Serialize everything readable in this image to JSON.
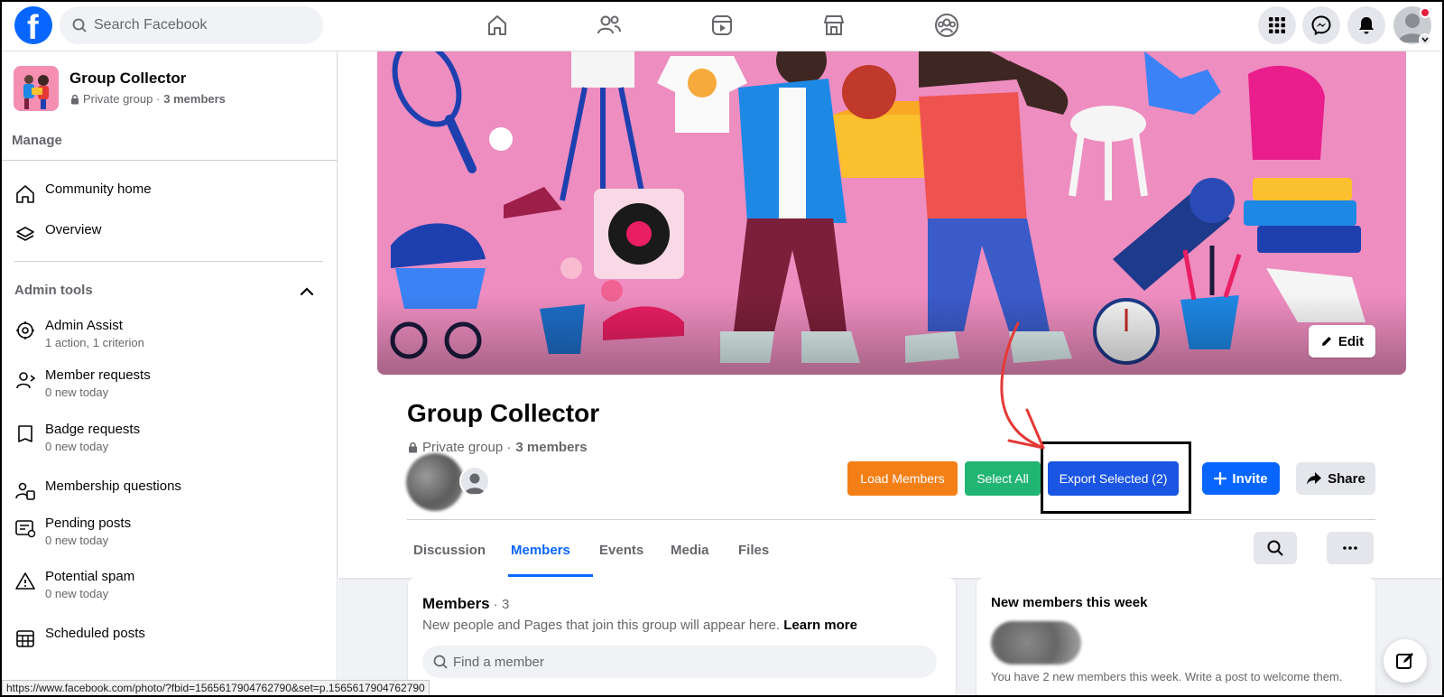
{
  "topbar": {
    "search_placeholder": "Search Facebook"
  },
  "sidebar": {
    "group_name": "Group Collector",
    "privacy": "Private group · ",
    "members": "3 members",
    "manage_label": "Manage",
    "items_top": [
      {
        "label": "Community home",
        "icon": "home-icon"
      },
      {
        "label": "Overview",
        "icon": "layers-icon"
      }
    ],
    "admin_tools_label": "Admin tools",
    "admin_items": [
      {
        "label": "Admin Assist",
        "sub": "1 action, 1 criterion",
        "icon": "admin-assist-icon"
      },
      {
        "label": "Member requests",
        "sub": "0 new today",
        "icon": "member-request-icon"
      },
      {
        "label": "Badge requests",
        "sub": "0 new today",
        "icon": "badge-icon"
      },
      {
        "label": "Membership questions",
        "sub": "",
        "icon": "questions-icon"
      },
      {
        "label": "Pending posts",
        "sub": "0 new today",
        "icon": "pending-posts-icon"
      },
      {
        "label": "Potential spam",
        "sub": "0 new today",
        "icon": "warning-icon"
      },
      {
        "label": "Scheduled posts",
        "sub": "",
        "icon": "calendar-icon"
      }
    ]
  },
  "status_url": "https://www.facebook.com/photo/?fbid=1565617904762790&set=p.1565617904762790",
  "header": {
    "edit_label": "Edit",
    "title": "Group Collector",
    "privacy": "Private group · ",
    "members": "3 members",
    "load_members": "Load Members",
    "select_all": "Select All",
    "export_selected": "Export Selected (2)",
    "invite": "Invite",
    "share": "Share",
    "tabs": [
      "Discussion",
      "Members",
      "Events",
      "Media",
      "Files"
    ],
    "active_tab": "Members"
  },
  "members_card": {
    "title": "Members",
    "count": " · 3",
    "subtitle": "New people and Pages that join this group will appear here. ",
    "learn_more": "Learn more",
    "find_placeholder": "Find a member"
  },
  "new_members_card": {
    "title": "New members this week",
    "subtitle": "You have 2 new members this week. Write a post to welcome them."
  },
  "colors": {
    "brand": "#0866ff",
    "load_members": "#f57f17",
    "select_all": "#21b573",
    "export_selected": "#1a55e3",
    "annotation_arrow": "#e53935"
  }
}
